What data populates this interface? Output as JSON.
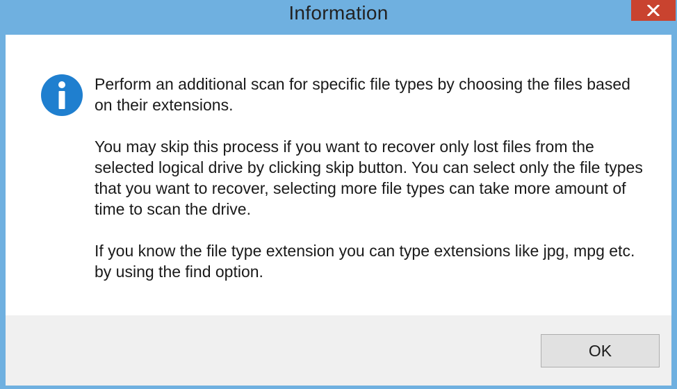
{
  "window": {
    "title": "Information",
    "close_icon": "close-icon",
    "close_color": "#c9432f",
    "frame_color": "#6fb0e0"
  },
  "message": {
    "icon": "info-icon",
    "icon_color": "#1f7fcf",
    "paragraphs": [
      "Perform an additional scan for specific file types by choosing the files based on their extensions.",
      "You may skip this process if you want to recover only lost files from the selected logical drive by clicking skip button. You can select only the file types that you want to recover, selecting more file types can take more amount of time to scan the drive.",
      "If you know the file type extension you can type extensions like jpg, mpg etc. by using the find option."
    ]
  },
  "footer": {
    "ok_label": "OK"
  }
}
